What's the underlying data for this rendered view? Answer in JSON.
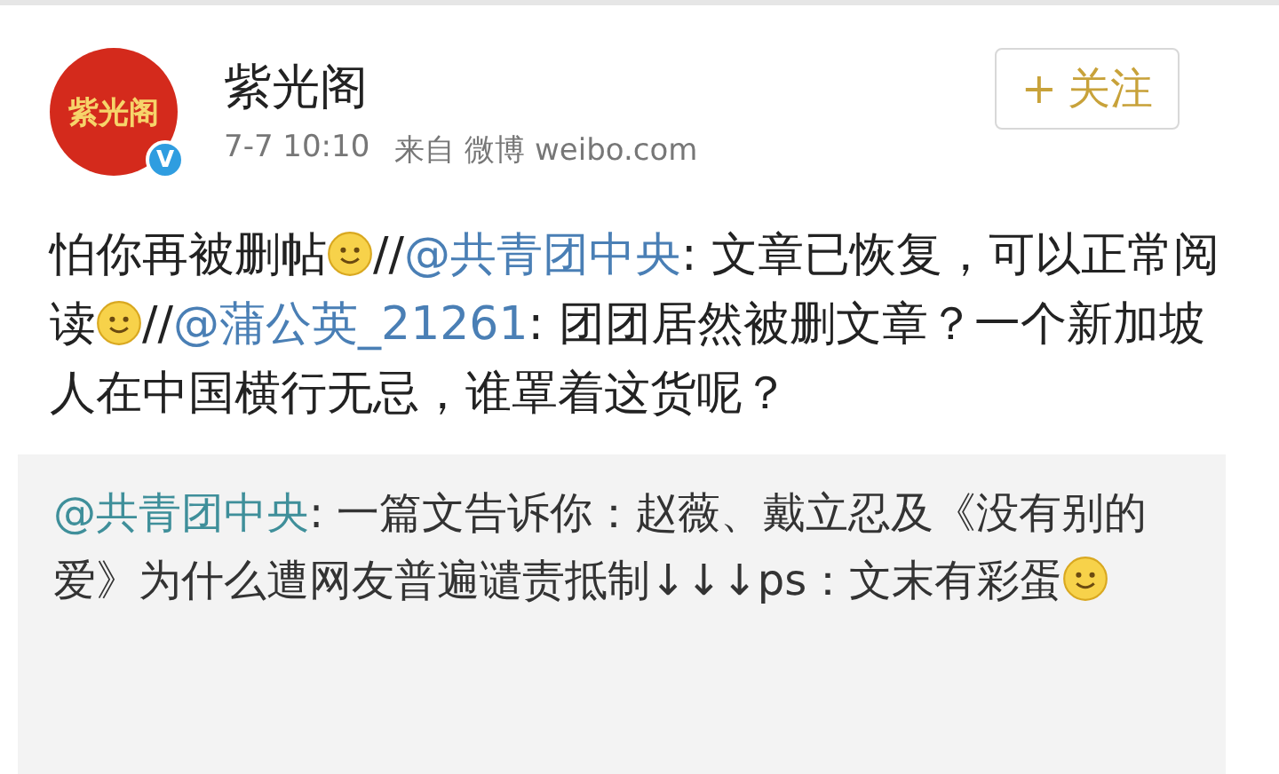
{
  "author": {
    "name": "紫光阁",
    "avatar_text": "紫光阁",
    "verified_badge": "V"
  },
  "meta": {
    "time": "7-7 10:10",
    "source": "来自 微博 weibo.com"
  },
  "follow_button": {
    "icon": "+",
    "label": "关注"
  },
  "post": {
    "segments": [
      {
        "kind": "text",
        "text": "怕你再被删帖"
      },
      {
        "kind": "emoji"
      },
      {
        "kind": "text",
        "text": "//"
      },
      {
        "kind": "mention",
        "text": "@共青团中央"
      },
      {
        "kind": "text",
        "text": ": 文章已恢复，可以正常阅读"
      },
      {
        "kind": "emoji"
      },
      {
        "kind": "text",
        "text": "//"
      },
      {
        "kind": "mention",
        "text": "@蒲公英_21261"
      },
      {
        "kind": "text",
        "text": ": 团团居然被删文章？一个新加坡人在中国横行无忌，谁罩着这货呢？"
      }
    ]
  },
  "repost": {
    "segments": [
      {
        "kind": "mention",
        "text": "@共青团中央"
      },
      {
        "kind": "text",
        "text": ": 一篇文告诉你：赵薇、戴立忍及《没有别的爱》为什么遭网友普遍谴责抵制↓↓↓ps：文末有彩蛋"
      },
      {
        "kind": "emoji"
      }
    ]
  }
}
